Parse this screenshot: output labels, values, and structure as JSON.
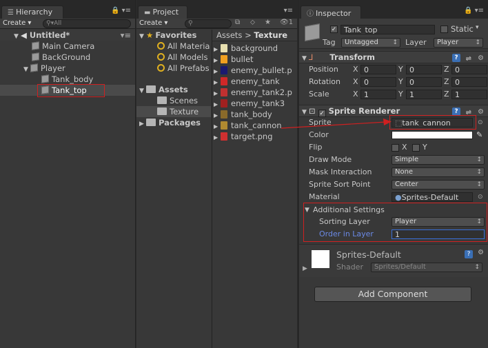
{
  "hierarchy": {
    "tab_label": "Hierarchy",
    "create_label": "Create",
    "search_placeholder": "All",
    "scene_name": "Untitled*",
    "items": [
      {
        "label": "Main Camera"
      },
      {
        "label": "BackGround"
      },
      {
        "label": "Player"
      },
      {
        "label": "Tank_body"
      },
      {
        "label": "Tank_top"
      }
    ]
  },
  "project": {
    "tab_label": "Project",
    "create_label": "Create",
    "favorites": {
      "label": "Favorites",
      "items": [
        "All Materia",
        "All Models",
        "All Prefabs"
      ]
    },
    "assets_label": "Assets",
    "assets_children": [
      "Scenes",
      "Texture"
    ],
    "packages_label": "Packages",
    "breadcrumb": {
      "root": "Assets",
      "current": "Texture"
    },
    "files": [
      {
        "name": "background",
        "icon_color": "#e8e0b0"
      },
      {
        "name": "bullet",
        "icon_color": "#f0a020"
      },
      {
        "name": "enemy_bullet.p",
        "icon_color": "#1a1a70"
      },
      {
        "name": "enemy_tank",
        "icon_color": "#d02828"
      },
      {
        "name": "enemy_tank2.p",
        "icon_color": "#c03030"
      },
      {
        "name": "enemy_tank3",
        "icon_color": "#a02020"
      },
      {
        "name": "tank_body",
        "icon_color": "#8a6a2a"
      },
      {
        "name": "tank_cannon",
        "icon_color": "#b08a30"
      },
      {
        "name": "target.png",
        "icon_color": "#d03030"
      }
    ],
    "counter": "1"
  },
  "inspector": {
    "tab_label": "Inspector",
    "object_name": "Tank_top",
    "static_label": "Static",
    "tag_label": "Tag",
    "tag_value": "Untagged",
    "layer_label": "Layer",
    "layer_value": "Player",
    "transform": {
      "title": "Transform",
      "position_label": "Position",
      "rotation_label": "Rotation",
      "scale_label": "Scale",
      "x_label": "X",
      "y_label": "Y",
      "z_label": "Z",
      "position": [
        "0",
        "0",
        "0"
      ],
      "rotation": [
        "0",
        "0",
        "0"
      ],
      "scale": [
        "1",
        "1",
        "1"
      ]
    },
    "sprite_renderer": {
      "title": "Sprite Renderer",
      "sprite_label": "Sprite",
      "sprite_value": "tank_cannon",
      "color_label": "Color",
      "flip_label": "Flip",
      "flip_x": "X",
      "flip_y": "Y",
      "draw_mode_label": "Draw Mode",
      "draw_mode_value": "Simple",
      "mask_label": "Mask Interaction",
      "mask_value": "None",
      "sort_point_label": "Sprite Sort Point",
      "sort_point_value": "Center",
      "material_label": "Material",
      "material_value": "Sprites-Default",
      "additional_label": "Additional Settings",
      "sorting_layer_label": "Sorting Layer",
      "sorting_layer_value": "Player",
      "order_label": "Order in Layer",
      "order_value": "1"
    },
    "material_preview": {
      "name": "Sprites-Default",
      "shader_label": "Shader",
      "shader_value": "Sprites/Default"
    },
    "add_component_label": "Add Component"
  },
  "colors": {
    "highlight_red": "#d02020",
    "order_label_blue": "#6b8ae6",
    "selection_bg": "#4a4a4a"
  }
}
